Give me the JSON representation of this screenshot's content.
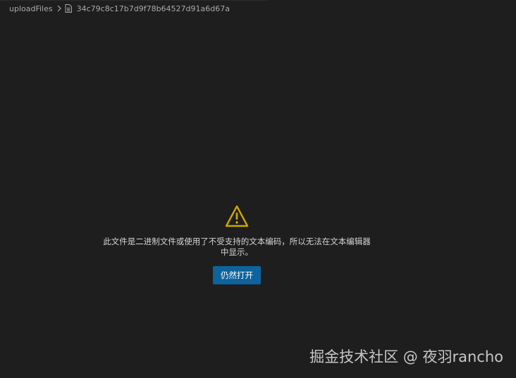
{
  "breadcrumb": {
    "folder": "uploadFiles",
    "separator_icon": "chevron-right-icon",
    "file_icon": "file-icon",
    "file": "34c79c8c17b7d9f78b64527d91a6d67a"
  },
  "notice": {
    "icon": "warning-icon",
    "message": "此文件是二进制文件或使用了不受支持的文本编码，所以无法在文本编辑器中显示。",
    "button_label": "仍然打开"
  },
  "watermark": {
    "text": "掘金技术社区 @ 夜羽rancho"
  },
  "colors": {
    "background": "#1e1e1e",
    "accent_button": "#0e639c",
    "warning": "#cca700"
  }
}
